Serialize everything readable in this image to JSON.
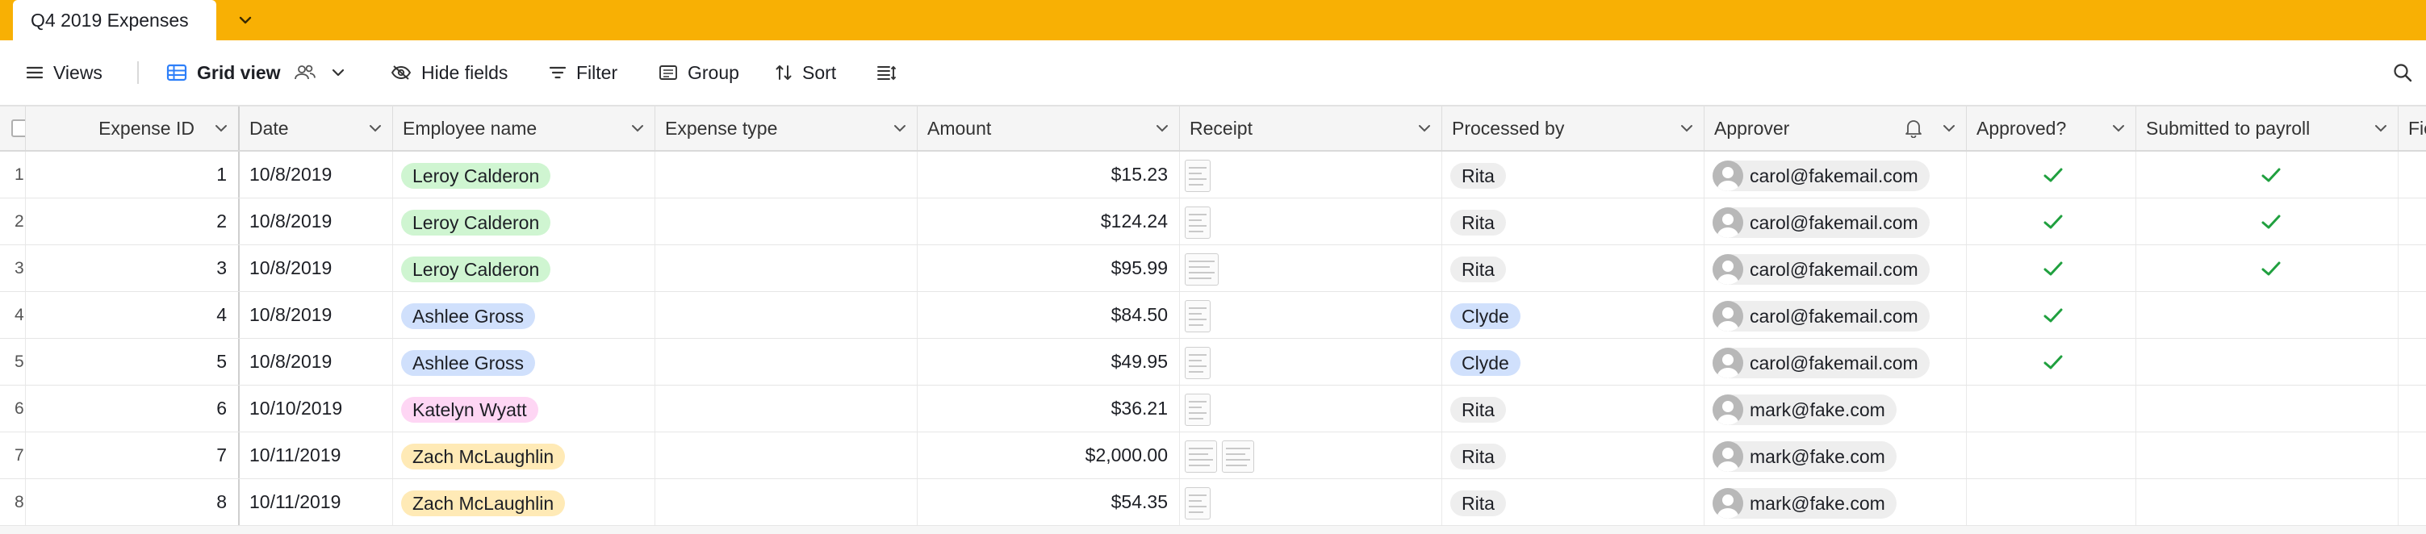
{
  "tab": {
    "title": "Q4 2019 Expenses"
  },
  "toolbar": {
    "views_label": "Views",
    "grid_view_label": "Grid view",
    "hide_fields_label": "Hide fields",
    "filter_label": "Filter",
    "group_label": "Group",
    "sort_label": "Sort"
  },
  "columns": {
    "expense_id": "Expense ID",
    "date": "Date",
    "employee_name": "Employee name",
    "expense_type": "Expense type",
    "amount": "Amount",
    "receipt": "Receipt",
    "processed_by": "Processed by",
    "approver": "Approver",
    "approved": "Approved?",
    "submitted": "Submitted to payroll",
    "next_field": "Fie"
  },
  "colors": {
    "tabbar": "#f8b004",
    "pill_green": "#cff5d1",
    "pill_blue": "#d0e0fc",
    "pill_pink": "#fed6f4",
    "pill_yellow": "#ffeab6",
    "pill_gray": "#eeeeee",
    "check_green": "#20a03f"
  },
  "rows": [
    {
      "num": "1",
      "id": "1",
      "date": "10/8/2019",
      "employee": "Leroy Calderon",
      "employee_color": "green",
      "amount": "$15.23",
      "receipts": 1,
      "processed": "Rita",
      "processed_color": "gray",
      "approver": "carol@fakemail.com",
      "approved": true,
      "submitted": true
    },
    {
      "num": "2",
      "id": "2",
      "date": "10/8/2019",
      "employee": "Leroy Calderon",
      "employee_color": "green",
      "amount": "$124.24",
      "receipts": 1,
      "processed": "Rita",
      "processed_color": "gray",
      "approver": "carol@fakemail.com",
      "approved": true,
      "submitted": true
    },
    {
      "num": "3",
      "id": "3",
      "date": "10/8/2019",
      "employee": "Leroy Calderon",
      "employee_color": "green",
      "amount": "$95.99",
      "receipts": 1,
      "processed": "Rita",
      "processed_color": "gray",
      "approver": "carol@fakemail.com",
      "approved": true,
      "submitted": true
    },
    {
      "num": "4",
      "id": "4",
      "date": "10/8/2019",
      "employee": "Ashlee Gross",
      "employee_color": "blue",
      "amount": "$84.50",
      "receipts": 1,
      "processed": "Clyde",
      "processed_color": "blue",
      "approver": "carol@fakemail.com",
      "approved": true,
      "submitted": false
    },
    {
      "num": "5",
      "id": "5",
      "date": "10/8/2019",
      "employee": "Ashlee Gross",
      "employee_color": "blue",
      "amount": "$49.95",
      "receipts": 1,
      "processed": "Clyde",
      "processed_color": "blue",
      "approver": "carol@fakemail.com",
      "approved": true,
      "submitted": false
    },
    {
      "num": "6",
      "id": "6",
      "date": "10/10/2019",
      "employee": "Katelyn Wyatt",
      "employee_color": "pink",
      "amount": "$36.21",
      "receipts": 1,
      "processed": "Rita",
      "processed_color": "gray",
      "approver": "mark@fake.com",
      "approved": false,
      "submitted": false
    },
    {
      "num": "7",
      "id": "7",
      "date": "10/11/2019",
      "employee": "Zach McLaughlin",
      "employee_color": "yellow",
      "amount": "$2,000.00",
      "receipts": 2,
      "processed": "Rita",
      "processed_color": "gray",
      "approver": "mark@fake.com",
      "approved": false,
      "submitted": false
    },
    {
      "num": "8",
      "id": "8",
      "date": "10/11/2019",
      "employee": "Zach McLaughlin",
      "employee_color": "yellow",
      "amount": "$54.35",
      "receipts": 1,
      "processed": "Rita",
      "processed_color": "gray",
      "approver": "mark@fake.com",
      "approved": false,
      "submitted": false
    }
  ],
  "icons": {
    "tab_menu": "chevron-down-icon",
    "views": "hamburger-icon",
    "grid_view": "grid-icon",
    "collaborators": "people-icon",
    "hide_fields": "eye-slash-icon",
    "filter": "filter-icon",
    "group": "group-icon",
    "sort": "sort-icon",
    "row_height": "row-height-icon",
    "search": "search-icon",
    "approver_notify": "bell-icon",
    "avatar": "avatar-icon",
    "checkmark": "checkmark-icon"
  }
}
